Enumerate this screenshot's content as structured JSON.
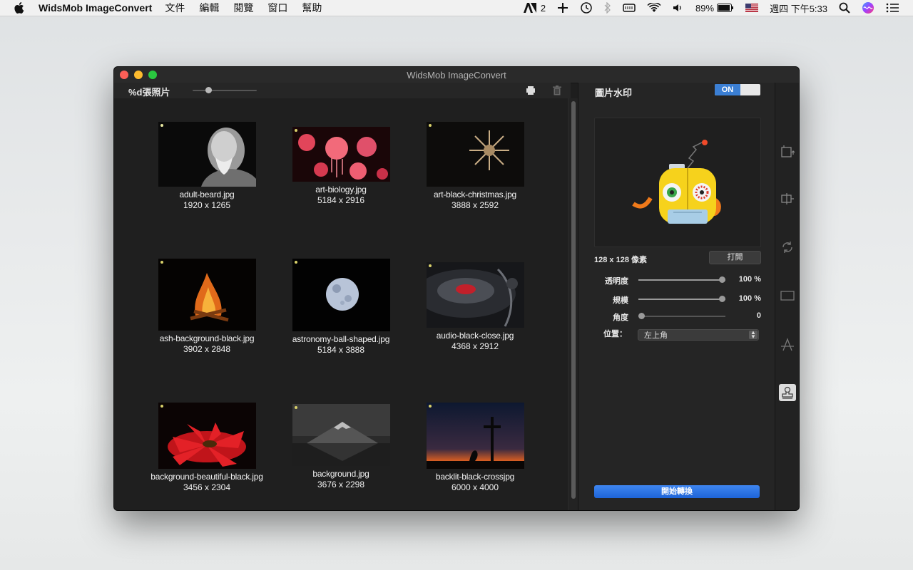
{
  "menubar": {
    "app_name": "WidsMob ImageConvert",
    "menus": [
      "文件",
      "編輯",
      "閱覽",
      "窗口",
      "幫助"
    ],
    "adobe_count": "2",
    "battery": "89%",
    "clock": "週四 下午5:33"
  },
  "window": {
    "title": "WidsMob ImageConvert",
    "photo_count_label": "%d張照片",
    "zoom_level": 0.22
  },
  "thumbnails": [
    {
      "name": "adult-beard.jpg",
      "size": "1920 x 1265"
    },
    {
      "name": "art-biology.jpg",
      "size": "5184 x 2916"
    },
    {
      "name": "art-black-christmas.jpg",
      "size": "3888 x 2592"
    },
    {
      "name": "ash-background-black.jpg",
      "size": "3902 x 2848"
    },
    {
      "name": "astronomy-ball-shaped.jpg",
      "size": "5184 x 3888"
    },
    {
      "name": "audio-black-close.jpg",
      "size": "4368 x 2912"
    },
    {
      "name": "background-beautiful-black.jpg",
      "size": "3456 x 2304"
    },
    {
      "name": "background.jpg",
      "size": "3676 x 2298"
    },
    {
      "name": "backlit-black-crossjpg",
      "size": "6000 x 4000"
    }
  ],
  "panel": {
    "title": "圖片水印",
    "toggle": "ON",
    "pixel_size": "128 x 128 像素",
    "open_label": "打開",
    "opacity_label": "透明度",
    "opacity_value": "100 %",
    "opacity_level": 1.0,
    "scale_label": "規模",
    "scale_value": "100 %",
    "scale_level": 1.0,
    "angle_label": "角度",
    "angle_value": "0",
    "angle_level": 0.0,
    "position_label": "位置：",
    "position_value": "左上角",
    "start_label": "開始轉換"
  },
  "colors": {
    "accent_blue": "#3b7fd4",
    "window_bg": "#1e1e1e",
    "panel_bg": "#252525"
  }
}
